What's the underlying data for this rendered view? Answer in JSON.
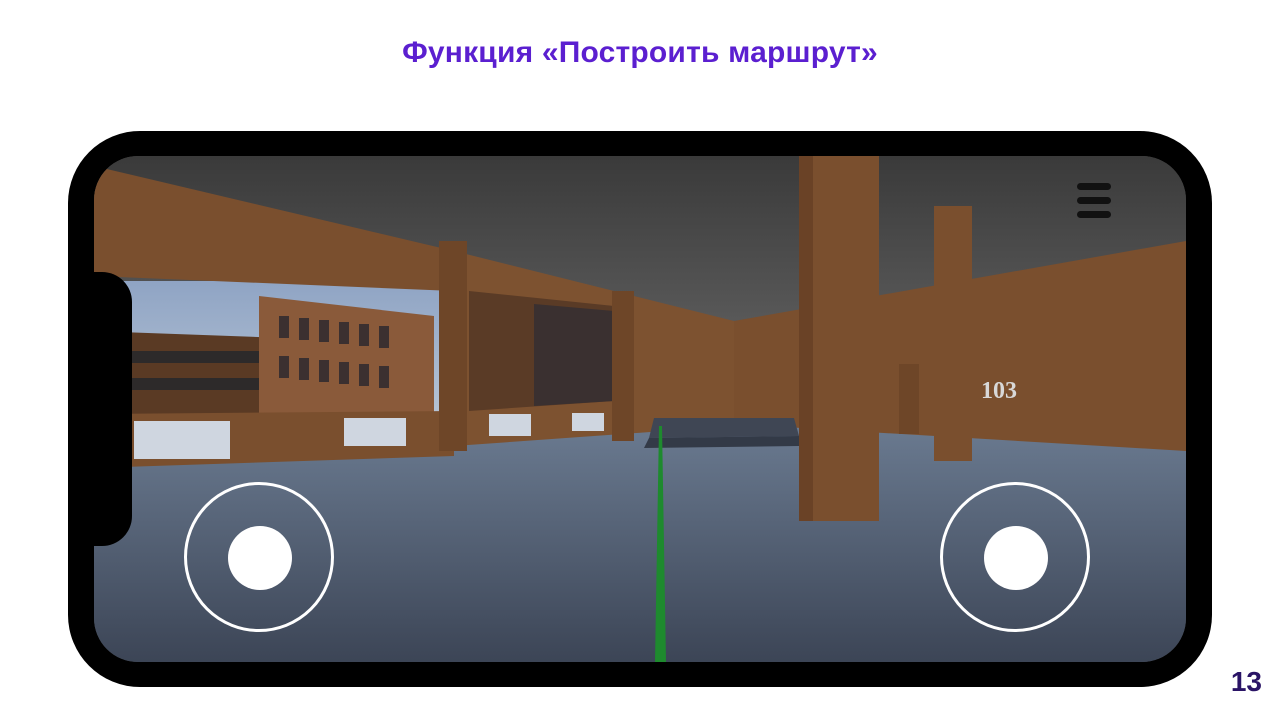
{
  "slide": {
    "title": "Функция «Построить маршрут»",
    "page_number": "13",
    "title_color": "#5b1fd0"
  },
  "game": {
    "room_label": "103",
    "route_line_color": "#1e8a2e",
    "wall_color": "#7a4f2e",
    "floor_color": "#566478",
    "ceiling_color": "#3a3a3a",
    "icons": {
      "menu": "hamburger-menu-icon",
      "left_joystick": "move-joystick",
      "right_joystick": "look-joystick"
    }
  }
}
